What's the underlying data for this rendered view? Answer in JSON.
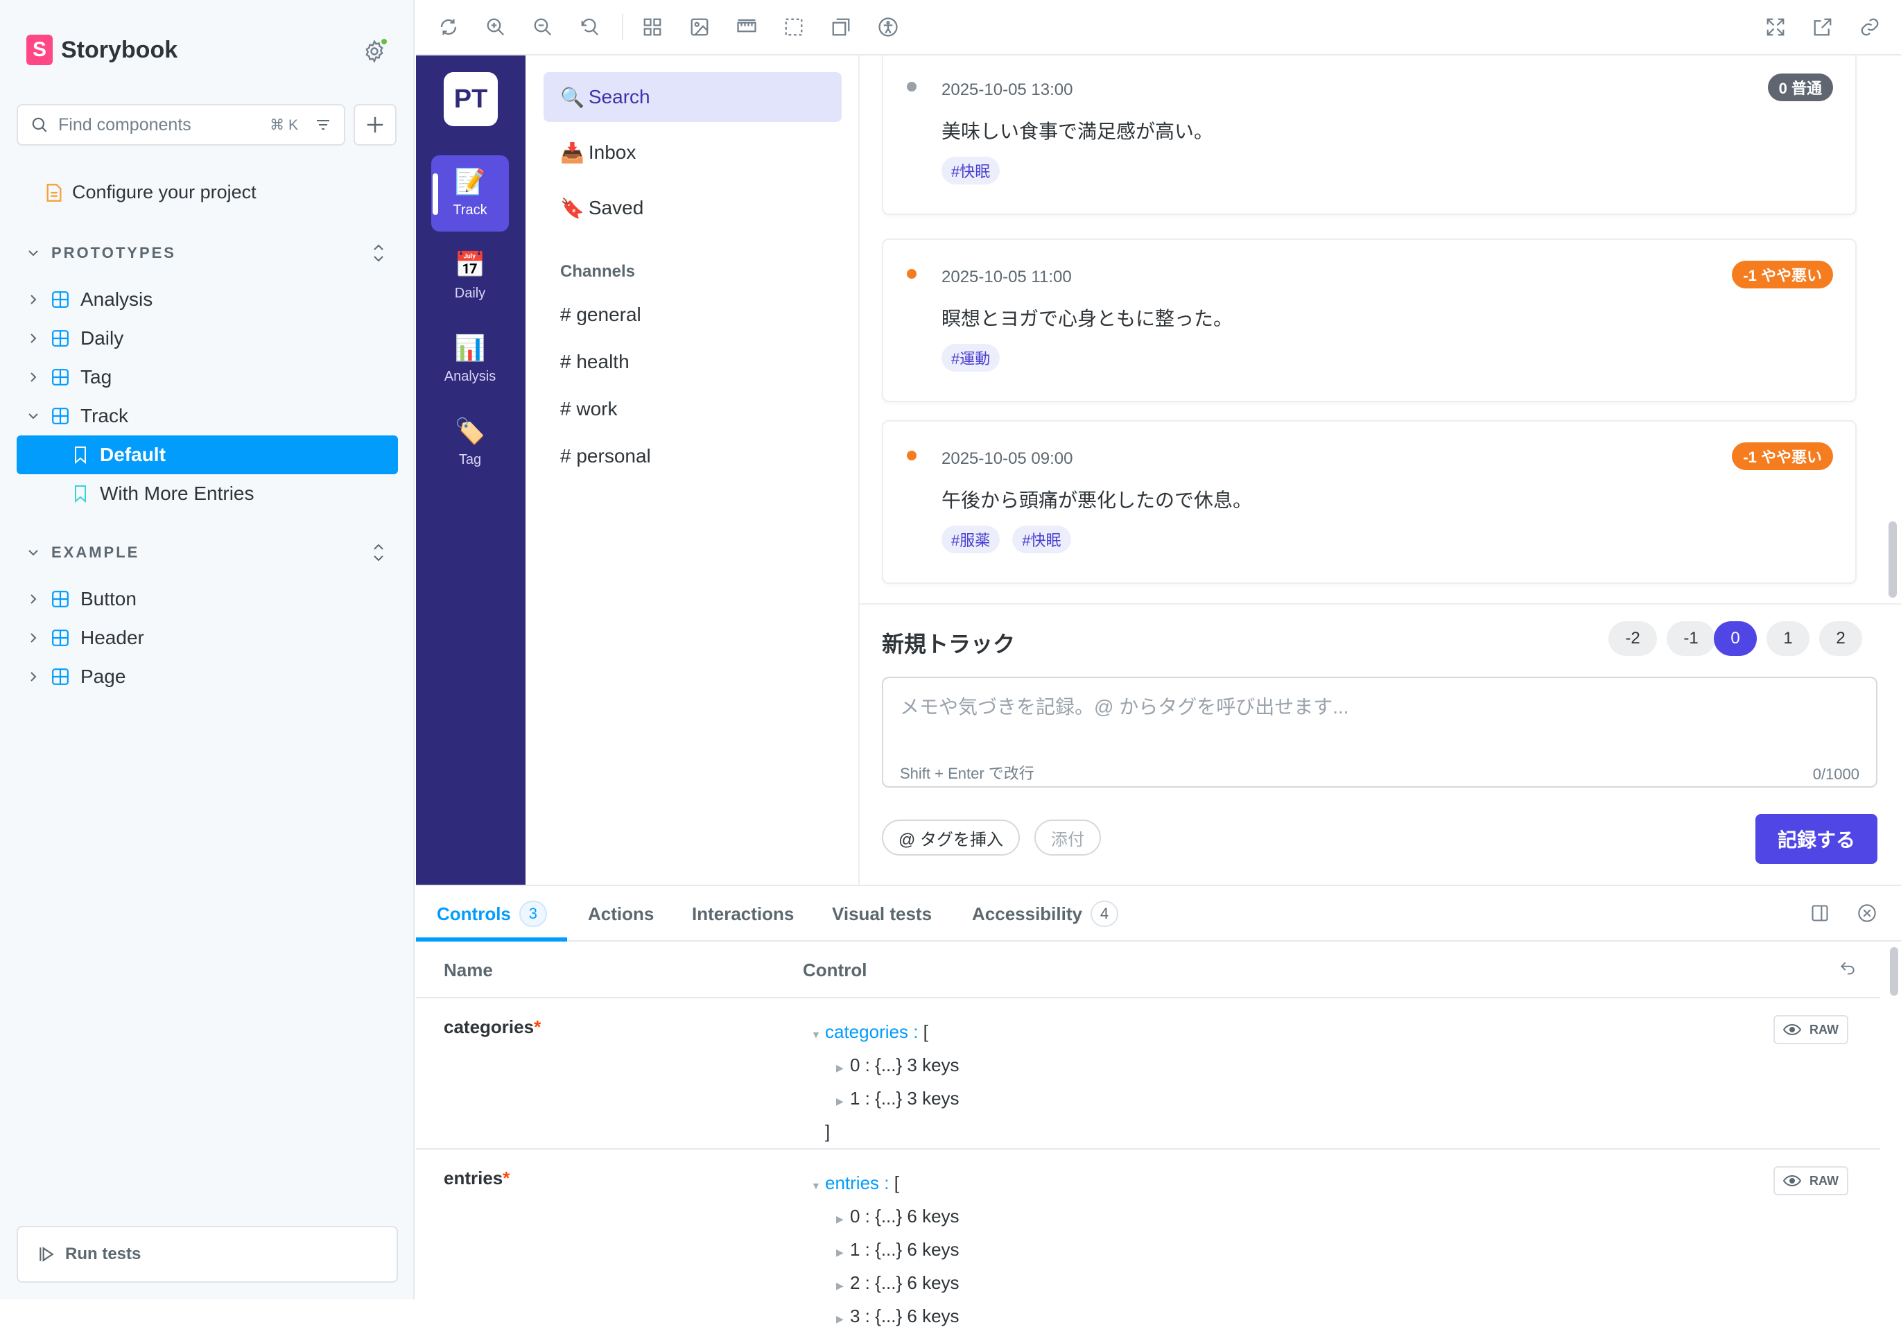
{
  "sidebar": {
    "brand": "Storybook",
    "search_placeholder": "Find components",
    "search_shortcut": "⌘ K",
    "configure": "Configure your project",
    "sections": [
      {
        "label": "PROTOTYPES"
      },
      {
        "label": "EXAMPLE"
      }
    ],
    "prototypes": [
      "Analysis",
      "Daily",
      "Tag",
      "Track"
    ],
    "track_stories": [
      "Default",
      "With More Entries"
    ],
    "example": [
      "Button",
      "Header",
      "Page"
    ],
    "run_tests": "Run tests"
  },
  "app": {
    "logo": "PT",
    "rail": [
      {
        "label": "Track",
        "icon": "📝"
      },
      {
        "label": "Daily",
        "icon": "📅"
      },
      {
        "label": "Analysis",
        "icon": "📊"
      },
      {
        "label": "Tag",
        "icon": "🏷️"
      }
    ],
    "nav": [
      {
        "icon": "🔍",
        "label": "Search"
      },
      {
        "icon": "📥",
        "label": "Inbox"
      },
      {
        "icon": "🔖",
        "label": "Saved"
      }
    ],
    "channels_heading": "Channels",
    "channels": [
      "# general",
      "# health",
      "# work",
      "# personal"
    ],
    "entries": [
      {
        "time": "2025-10-05 13:00",
        "text": "美味しい食事で満足感が高い。",
        "badge": "0 普通",
        "badge_color": "#5f6670",
        "dot_color": "#9aa0a8",
        "tags": [
          "#快眠"
        ]
      },
      {
        "time": "2025-10-05 11:00",
        "text": "瞑想とヨガで心身ともに整った。",
        "badge": "-1 やや悪い",
        "badge_color": "#f57c1f",
        "dot_color": "#f57c1f",
        "tags": [
          "#運動"
        ]
      },
      {
        "time": "2025-10-05 09:00",
        "text": "午後から頭痛が悪化したので休息。",
        "badge": "-1 やや悪い",
        "badge_color": "#f57c1f",
        "dot_color": "#f57c1f",
        "tags": [
          "#服薬",
          "#快眠"
        ]
      }
    ],
    "composer": {
      "title": "新規トラック",
      "scores": [
        "-2",
        "-1",
        "0",
        "1",
        "2"
      ],
      "selected_score": "0",
      "placeholder": "メモや気づきを記録。@ からタグを呼び出せます...",
      "hint": "Shift + Enter で改行",
      "counter": "0/1000",
      "insert_tag": "@ タグを挿入",
      "attach": "添付",
      "submit": "記録する"
    }
  },
  "addons": {
    "tabs": [
      {
        "label": "Controls",
        "count": "3"
      },
      {
        "label": "Actions"
      },
      {
        "label": "Interactions"
      },
      {
        "label": "Visual tests"
      },
      {
        "label": "Accessibility",
        "count": "4"
      }
    ],
    "col_name": "Name",
    "col_control": "Control",
    "raw": "RAW",
    "rows": [
      {
        "name": "categories",
        "key": "categories",
        "items": [
          "0 : {...} 3 keys",
          "1 : {...} 3 keys"
        ]
      },
      {
        "name": "entries",
        "key": "entries",
        "items": [
          "0 : {...} 6 keys",
          "1 : {...} 6 keys",
          "2 : {...} 6 keys",
          "3 : {...} 6 keys"
        ]
      }
    ]
  },
  "colors": {
    "accent": "#029cfd",
    "brand": "#ff4785",
    "app_primary": "#4f46e5",
    "rail": "#302a7a"
  }
}
